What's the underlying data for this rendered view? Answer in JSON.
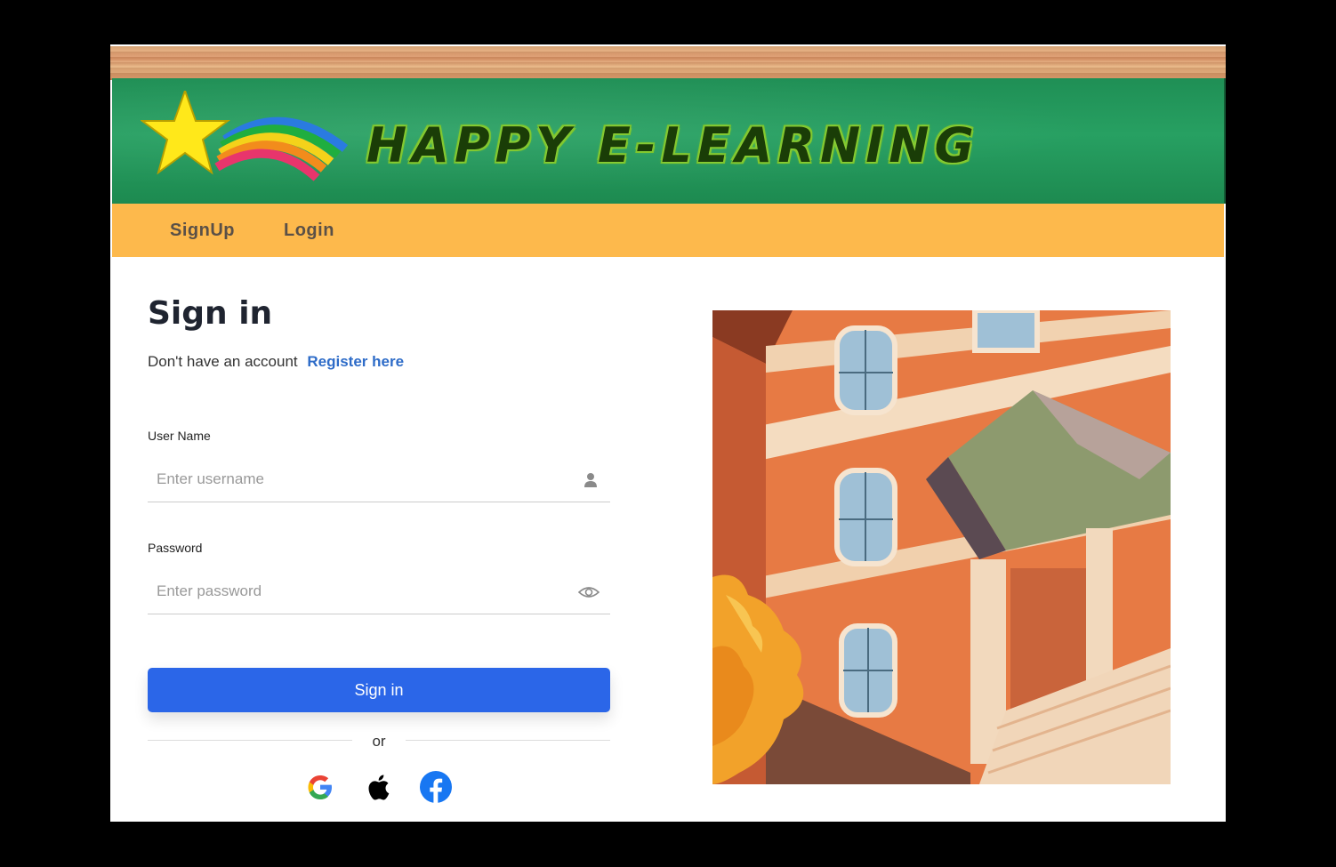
{
  "header": {
    "brand": "HAPPY E-LEARNING"
  },
  "nav": {
    "items": [
      {
        "label": "SignUp"
      },
      {
        "label": "Login"
      }
    ]
  },
  "form": {
    "title": "Sign in",
    "no_account_text": "Don't have an account",
    "register_link": "Register here",
    "username_label": "User Name",
    "username_placeholder": "Enter username",
    "password_label": "Password",
    "password_placeholder": "Enter password",
    "submit_label": "Sign in",
    "divider_text": "or"
  },
  "social": [
    "google-icon",
    "apple-icon",
    "facebook-icon"
  ],
  "colors": {
    "nav_bg": "#fdb94c",
    "board": "#1f8f55",
    "primary_button": "#2b66e8",
    "link": "#2e6cc8"
  }
}
